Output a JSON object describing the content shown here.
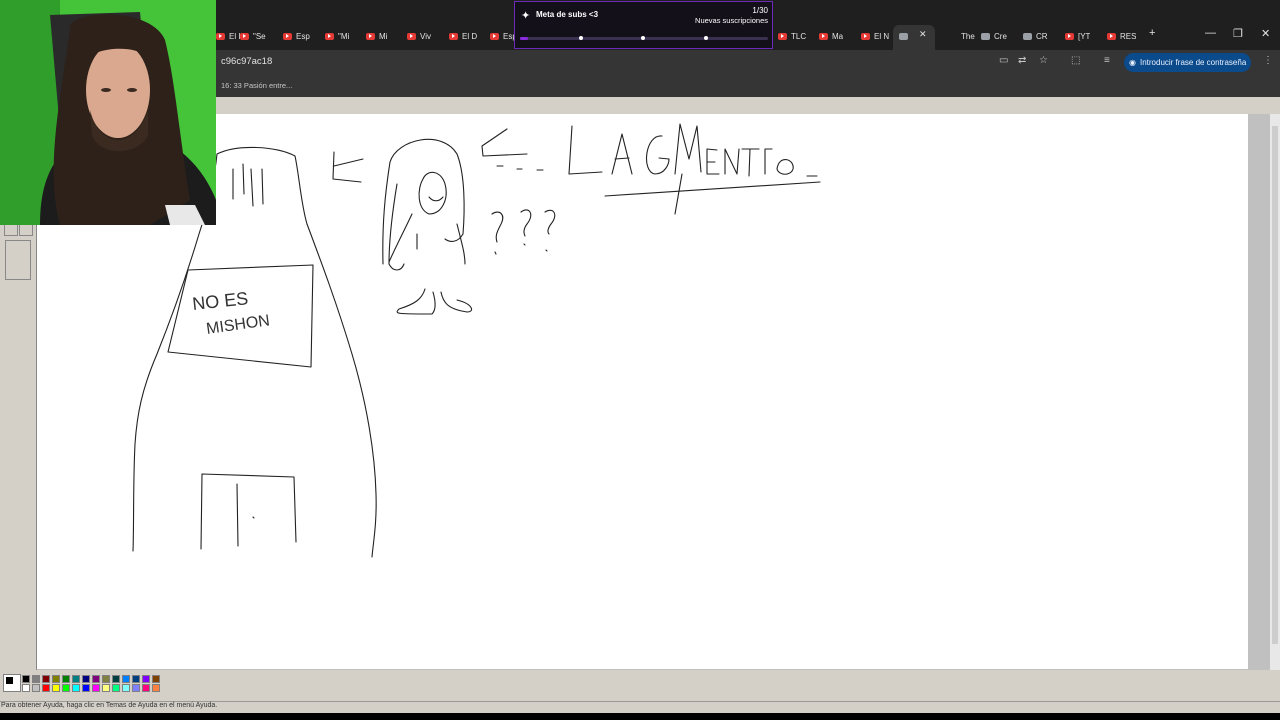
{
  "browser": {
    "tabs": [
      {
        "label": "El I",
        "icon": "youtube-icon"
      },
      {
        "label": "\"Se",
        "icon": "youtube-icon"
      },
      {
        "label": "Esp",
        "icon": "youtube-icon"
      },
      {
        "label": "\"Mi",
        "icon": "youtube-icon"
      },
      {
        "label": "Mi",
        "icon": "youtube-icon"
      },
      {
        "label": "Viv",
        "icon": "youtube-icon"
      },
      {
        "label": "El D",
        "icon": "youtube-icon"
      },
      {
        "label": "Esp",
        "icon": "youtube-icon"
      },
      {
        "label": "TLC",
        "icon": "youtube-icon"
      },
      {
        "label": "Ma",
        "icon": "youtube-icon"
      },
      {
        "label": "El N",
        "icon": "youtube-icon"
      },
      {
        "label": "",
        "icon": "page-icon"
      },
      {
        "label": "The",
        "icon": "none"
      },
      {
        "label": "Cre",
        "icon": "patreon-icon"
      },
      {
        "label": "CR",
        "icon": "page-icon"
      },
      {
        "label": "[YT",
        "icon": "youtube-icon"
      },
      {
        "label": "RES",
        "icon": "youtube-icon"
      }
    ],
    "url": "c96c97ac18",
    "password_button_label": "Introducir frase de contraseña",
    "bookmark_label": "16: 33 Pasión entre..."
  },
  "overlay": {
    "goal_title": "Meta de subs <3",
    "goal_count": "1/30",
    "goal_subtitle": "Nuevas suscripciones",
    "goal_progress": 0.033
  },
  "paint": {
    "status_text": "Para obtener Ayuda, haga clic en Temas de Ayuda en el menú Ayuda.",
    "palette": [
      "#000000",
      "#808080",
      "#800000",
      "#808000",
      "#008000",
      "#008080",
      "#000080",
      "#800080",
      "#808040",
      "#004040",
      "#0080ff",
      "#004080",
      "#8000ff",
      "#804000",
      "#ffffff",
      "#c0c0c0",
      "#ff0000",
      "#ffff00",
      "#00ff00",
      "#00ffff",
      "#0000ff",
      "#ff00ff",
      "#ffff80",
      "#00ff80",
      "#80ffff",
      "#8080ff",
      "#ff0080",
      "#ff8040"
    ],
    "drawing_texts": [
      "NO ES",
      "MISHON",
      "LAGMENTAL",
      "???"
    ]
  }
}
